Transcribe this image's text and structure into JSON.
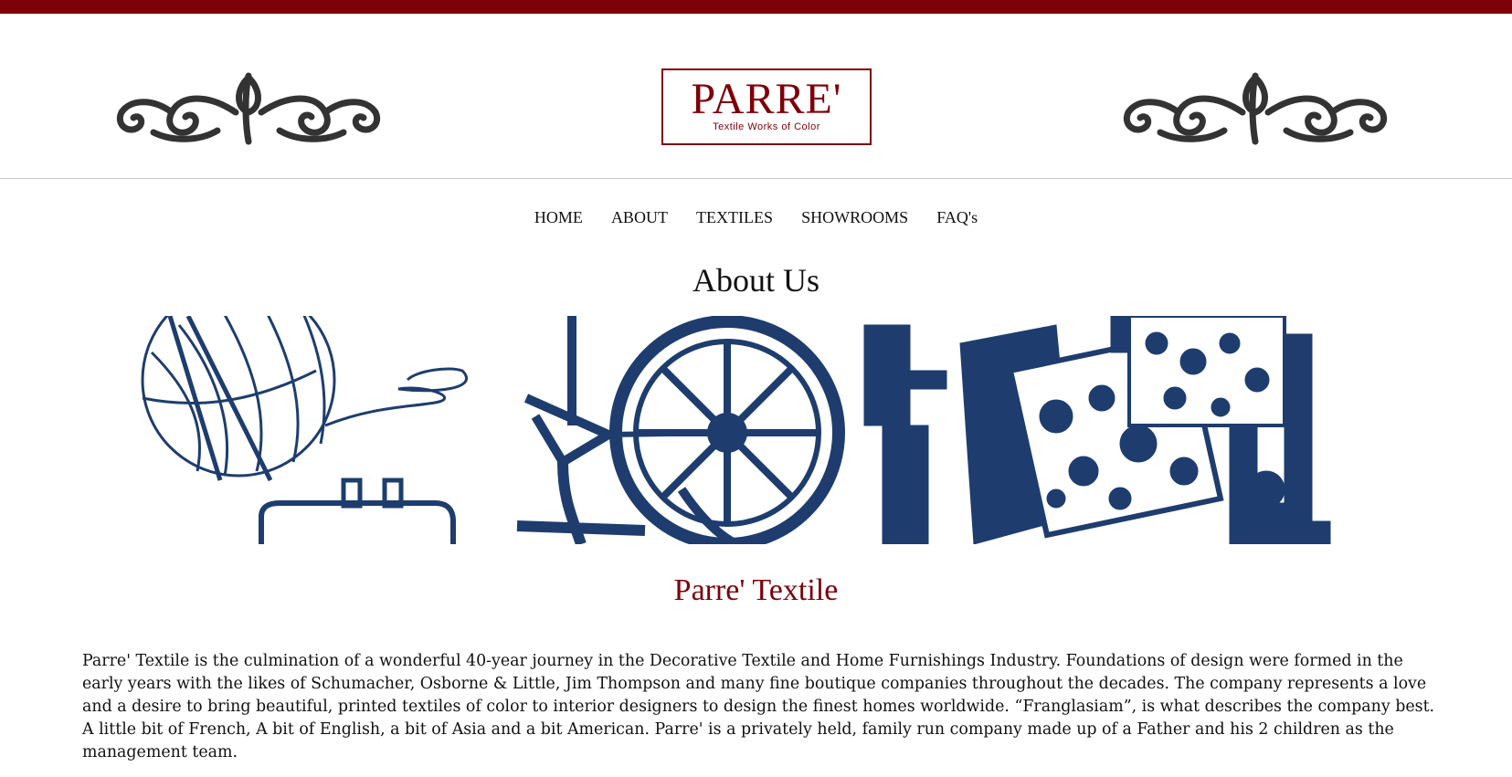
{
  "brand": {
    "name": "PARRE'",
    "tagline": "Textile Works of Color",
    "accent_color": "#7c0009",
    "illustration_color": "#1e3d6e"
  },
  "nav": {
    "items": [
      {
        "label": "HOME"
      },
      {
        "label": "ABOUT"
      },
      {
        "label": "TEXTILES"
      },
      {
        "label": "SHOWROOMS"
      },
      {
        "label": "FAQ's"
      }
    ]
  },
  "page": {
    "title": "About Us"
  },
  "section": {
    "title": "Parre' Textile",
    "body": "Parre' Textile is the culmination of a wonderful 40-year journey in the Decorative Textile and Home Furnishings Industry. Foundations of design were formed in the early years with the likes of Schumacher, Osborne & Little, Jim Thompson and many fine boutique companies throughout the decades. The company represents a love and a desire to bring beautiful, printed textiles of color to interior designers to design the finest homes worldwide. “Franglasiam”, is what describes the company best. A little bit of French, A bit of English, a bit of Asia and a bit American. Parre' is a privately held, family run company made up of a Father and his 2 children as the management team."
  },
  "icons": [
    "scroll-ornament-icon",
    "yarn-ball-icon",
    "spinning-wheel-icon",
    "textile-printing-icon"
  ]
}
